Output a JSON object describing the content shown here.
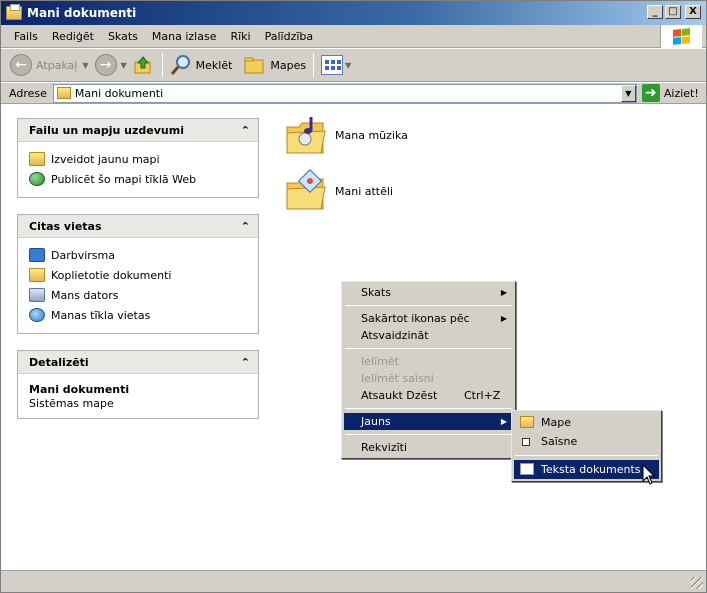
{
  "window": {
    "title": "Mani dokumenti"
  },
  "titlebar_buttons": {
    "minimize": "_",
    "maximize": "□",
    "close": "X"
  },
  "menubar": [
    "Fails",
    "Rediģēt",
    "Skats",
    "Mana izlase",
    "Rīki",
    "Palīdzība"
  ],
  "toolbar": {
    "back_label": "Atpakaļ",
    "search_label": "Meklēt",
    "folders_label": "Mapes"
  },
  "address": {
    "label": "Adrese",
    "value": "Mani dokumenti",
    "go_label": "Aiziet!"
  },
  "panes": {
    "tasks": {
      "title": "Failu un mapju uzdevumi",
      "items": [
        "Izveidot jaunu mapi",
        "Publicēt šo mapi tīklā Web"
      ]
    },
    "places": {
      "title": "Citas vietas",
      "items": [
        "Darbvirsma",
        "Koplietotie dokumenti",
        "Mans dators",
        "Manas tīkla vietas"
      ]
    },
    "details": {
      "title": "Detalizēti",
      "name": "Mani dokumenti",
      "type": "Sistēmas mape"
    }
  },
  "content": {
    "items": [
      "Mana mūzika",
      "Mani attēli"
    ]
  },
  "context_menu": {
    "view": "Skats",
    "arrange": "Sakārtot ikonas pēc",
    "refresh": "Atsvaidzināt",
    "paste": "Ielīmēt",
    "paste_shortcut": "Ielīmēt saīsni",
    "undo": "Atsaukt Dzēst",
    "undo_key": "Ctrl+Z",
    "new": "Jauns",
    "properties": "Rekvizīti"
  },
  "submenu": {
    "folder": "Mape",
    "shortcut": "Saīsne",
    "text_doc": "Teksta dokuments"
  }
}
